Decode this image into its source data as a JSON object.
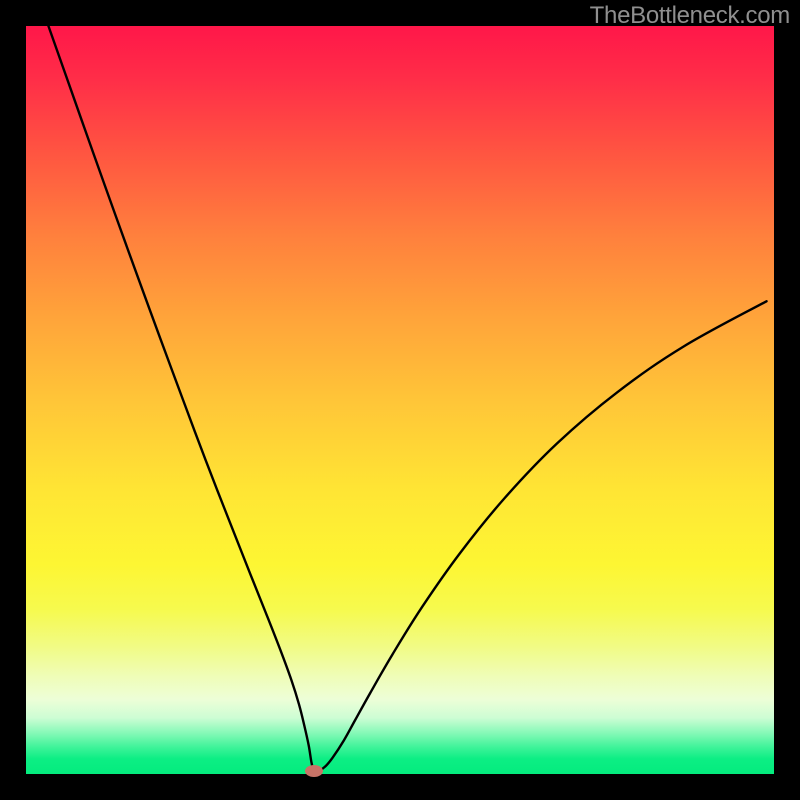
{
  "watermark": "TheBottleneck.com",
  "chart_data": {
    "type": "line",
    "title": "",
    "xlabel": "",
    "ylabel": "",
    "xlim": [
      0,
      100
    ],
    "ylim": [
      0,
      100
    ],
    "grid": false,
    "legend": false,
    "series": [
      {
        "name": "curve",
        "x": [
          3,
          6,
          9,
          12,
          15,
          18,
          21,
          24,
          27,
          30,
          32,
          34,
          35.5,
          36.5,
          37.2,
          37.8,
          38.3,
          39,
          40,
          41,
          42.5,
          44,
          46,
          49,
          53,
          58,
          64,
          71,
          79,
          88,
          99
        ],
        "y": [
          100,
          91.5,
          83,
          74.6,
          66.3,
          58.1,
          50,
          42,
          34.3,
          26.7,
          21.7,
          16.6,
          12.5,
          9.3,
          6.5,
          3.8,
          1.0,
          0.4,
          1.0,
          2.2,
          4.5,
          7.2,
          10.8,
          16,
          22.4,
          29.5,
          36.9,
          44.2,
          51.0,
          57.2,
          63.2
        ]
      }
    ],
    "marker": {
      "x": 38.5,
      "y": 0.4
    },
    "gradient_stops": [
      {
        "pos": 0,
        "color": "#ff1749"
      },
      {
        "pos": 0.5,
        "color": "#ffc538"
      },
      {
        "pos": 0.78,
        "color": "#f6fa4e"
      },
      {
        "pos": 1.0,
        "color": "#04ec7e"
      }
    ]
  }
}
